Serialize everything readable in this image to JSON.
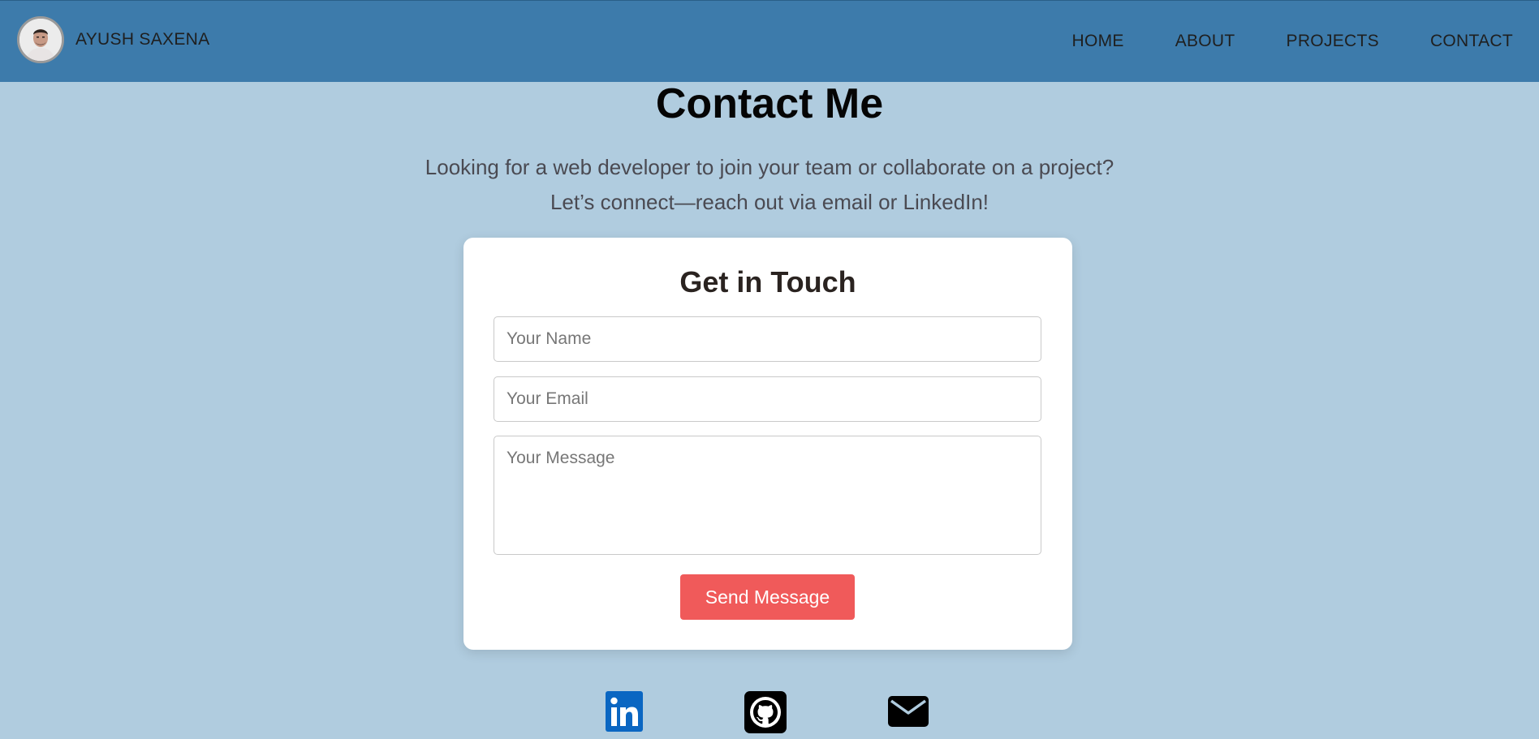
{
  "nav": {
    "brand_name": "AYUSH SAXENA",
    "links": [
      "HOME",
      "ABOUT",
      "PROJECTS",
      "CONTACT"
    ]
  },
  "main": {
    "title": "Contact Me",
    "intro_line1": "Looking for a web developer to join your team or collaborate on a project?",
    "intro_line2": "Let’s connect—reach out via email or LinkedIn!"
  },
  "form": {
    "title": "Get in Touch",
    "name_placeholder": "Your Name",
    "email_placeholder": "Your Email",
    "message_placeholder": "Your Message",
    "submit_label": "Send Message"
  },
  "social": [
    {
      "icon": "linkedin-icon",
      "color": "#0a66c2"
    },
    {
      "icon": "github-icon",
      "color": "#000000"
    },
    {
      "icon": "envelope-icon",
      "color": "#000000"
    }
  ],
  "colors": {
    "nav_bg": "#3d7bab",
    "page_bg": "#b0ccdf",
    "button_bg": "#f05a5a"
  }
}
